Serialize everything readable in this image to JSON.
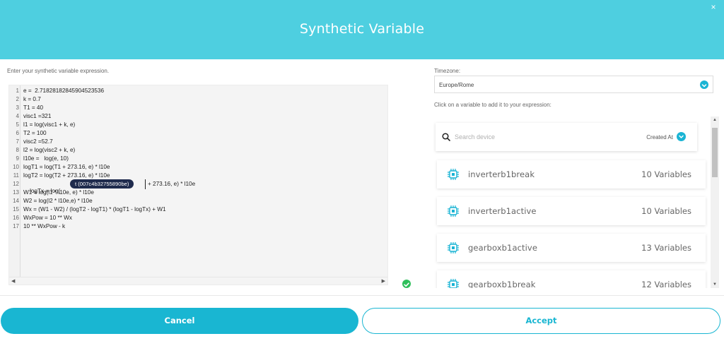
{
  "dialog": {
    "title": "Synthetic Variable",
    "close_label": "×"
  },
  "editor": {
    "instruction": "Enter your synthetic variable expression.",
    "lines": [
      {
        "num": "1",
        "text": "e =  2.71828182845904523536"
      },
      {
        "num": "2",
        "text": "k = 0.7"
      },
      {
        "num": "3",
        "text": "T1 = 40"
      },
      {
        "num": "4",
        "text": "visc1 =321"
      },
      {
        "num": "5",
        "text": "l1 = log(visc1 + k, e)"
      },
      {
        "num": "6",
        "text": "T2 = 100"
      },
      {
        "num": "7",
        "text": "visc2 =52.7"
      },
      {
        "num": "8",
        "text": "l2 = log(visc2 + k, e)"
      },
      {
        "num": "9",
        "text": "l10e =   log(e, 10)"
      },
      {
        "num": "10",
        "text": "logT1 = log(T1 + 273.16, e) * l10e"
      },
      {
        "num": "11",
        "text": "logT2 = log(T2 + 273.16, e) * l10e"
      },
      {
        "num": "12",
        "text": "logTx = log("
      },
      {
        "num": "13",
        "text": "W1 = log(l1 * l10e, e) * l10e"
      },
      {
        "num": "14",
        "text": "W2 = log(l2 * l10e,e) * l10e"
      },
      {
        "num": "15",
        "text": "Wx = (W1 - W2) / (logT2 - logT1) * (logT1 - logTx) + W1"
      },
      {
        "num": "16",
        "text": "WxPow = 10 ** Wx"
      },
      {
        "num": "17",
        "text": "10 ** WxPow - k"
      }
    ],
    "line12_token": "t (007c4b32755890be)",
    "line12_rest": "+ 273.16, e) * l10e"
  },
  "timezone": {
    "label": "Timezone:",
    "value": "Europe/Rome"
  },
  "variables": {
    "hint": "Click on a variable to add it to your expression:",
    "search_placeholder": "Search device",
    "sort_label": "Created At",
    "devices": [
      {
        "name": "inverterb1break",
        "count": "10 Variables"
      },
      {
        "name": "inverterb1active",
        "count": "10 Variables"
      },
      {
        "name": "gearboxb1active",
        "count": "13 Variables"
      },
      {
        "name": "gearboxb1break",
        "count": "12 Variables"
      }
    ]
  },
  "actions": {
    "cancel_label": "Cancel",
    "accept_label": "Accept"
  },
  "colors": {
    "header": "#4ecfe0",
    "accent": "#19b6d2",
    "token_pill": "#1f2b4d",
    "valid": "#2fbf5b"
  },
  "icons": {
    "close": "close-icon",
    "search": "search-icon",
    "chevron": "chevron-down-icon",
    "device": "chip-icon",
    "valid": "check-icon"
  }
}
